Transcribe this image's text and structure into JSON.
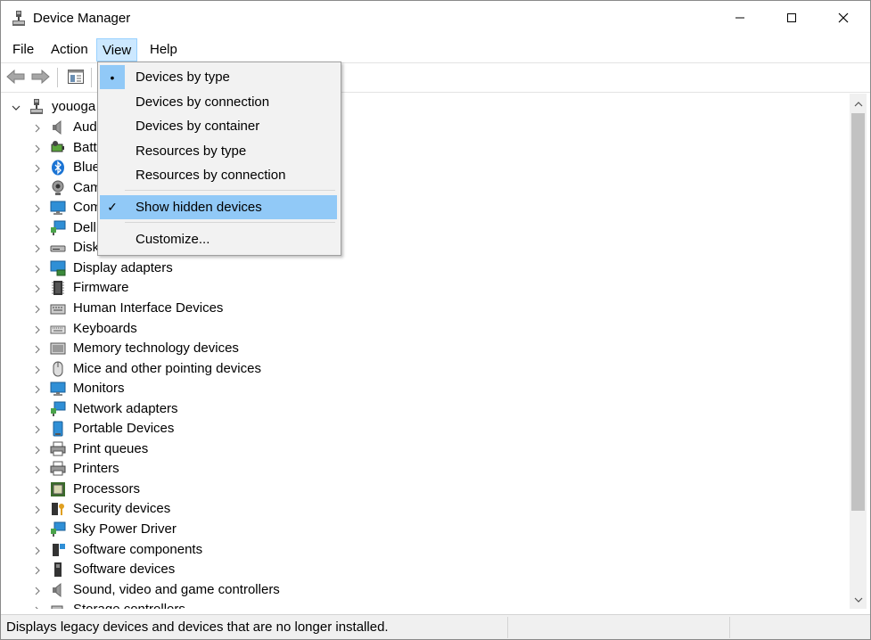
{
  "window": {
    "title": "Device Manager"
  },
  "titlebar_buttons": [
    "minimize-icon",
    "maximize-icon",
    "close-icon"
  ],
  "menubar": {
    "items": [
      "File",
      "Action",
      "View",
      "Help"
    ],
    "open_menu": "View"
  },
  "toolbar": {
    "buttons": [
      "back-arrow-icon",
      "forward-arrow-icon",
      "properties-panel-icon"
    ]
  },
  "tree": {
    "root": "youoga",
    "categories": [
      "Aud",
      "Batt",
      "Blue",
      "Cam",
      "Com",
      "Dell",
      "Disk",
      "Display adapters",
      "Firmware",
      "Human Interface Devices",
      "Keyboards",
      "Memory technology devices",
      "Mice and other pointing devices",
      "Monitors",
      "Network adapters",
      "Portable Devices",
      "Print queues",
      "Printers",
      "Processors",
      "Security devices",
      "Sky Power Driver",
      "Software components",
      "Software devices",
      "Sound, video and game controllers",
      "Storage controllers"
    ]
  },
  "view_menu": {
    "items": [
      {
        "label": "Devices by type",
        "mark": "•"
      },
      {
        "label": "Devices by connection",
        "mark": ""
      },
      {
        "label": "Devices by container",
        "mark": ""
      },
      {
        "label": "Resources by type",
        "mark": ""
      },
      {
        "label": "Resources by connection",
        "mark": ""
      },
      {
        "label": "Show hidden devices",
        "mark": "✓"
      },
      {
        "label": "Customize...",
        "mark": ""
      }
    ]
  },
  "statusbar": {
    "text": "Displays legacy devices and devices that are no longer installed."
  },
  "colors": {
    "highlight": "#91c9f7",
    "menu_open": "#cce8ff",
    "menu_bg": "#f2f2f2"
  }
}
